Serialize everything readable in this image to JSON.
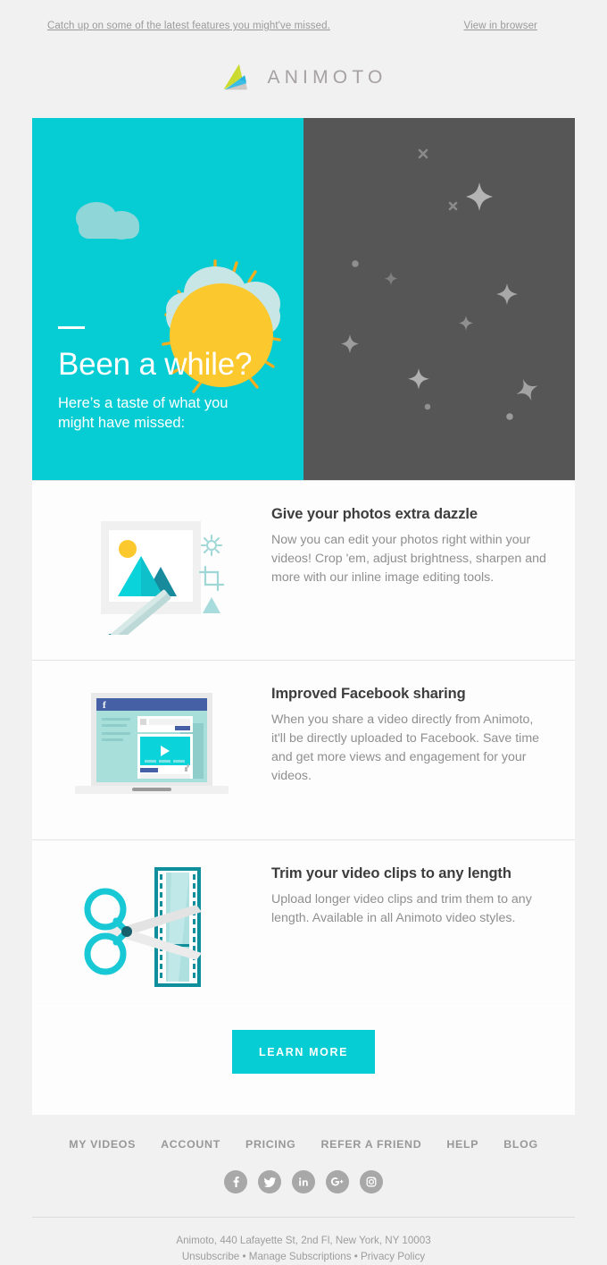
{
  "preheader": {
    "catchup_text": "Catch up on some of the latest features you might've missed.",
    "view_in_browser": "View in browser"
  },
  "brand": {
    "name": "ANIMOTO",
    "logo_icon": "animoto-triangle-logo",
    "colors": {
      "cyan": "#06cdd4",
      "yellow_green": "#d8e06a",
      "blue": "#3bbde4",
      "gray": "#cfcac6",
      "dark_panel": "#565656",
      "page_bg": "#f1f1f1",
      "card_bg": "#fdfdfd",
      "heading": "#3d3d3d",
      "body_text": "#8f8f8f",
      "footer_text": "#989898",
      "sun_yellow": "#fbc82d",
      "cloud": "#bfe3e3"
    }
  },
  "hero": {
    "dash": "",
    "title": "Been a while?",
    "subtitle": "Here’s a taste of what you might have missed:",
    "left_icons": [
      "cloud-icon",
      "sun-icon"
    ],
    "right_icons": [
      "star-icon",
      "sparkle-icon",
      "dot-icon"
    ]
  },
  "features": [
    {
      "icon": "photo-editing-illustration",
      "title": "Give your photos extra dazzle",
      "body": "Now you can edit your photos right within your videos! Crop 'em, adjust brightness, sharpen and more with our inline image editing tools."
    },
    {
      "icon": "facebook-laptop-illustration",
      "title": "Improved Facebook sharing",
      "body": "When you share a video directly from Animoto, it'll be directly uploaded to Facebook. Save time and get more views and engagement for your videos."
    },
    {
      "icon": "scissors-filmstrip-illustration",
      "title": "Trim your video clips to any length",
      "body": "Upload longer video clips and trim them to any length. Available in all Animoto video styles."
    }
  ],
  "cta": {
    "label": "LEARN MORE"
  },
  "footer": {
    "nav": [
      {
        "label": "MY VIDEOS"
      },
      {
        "label": "ACCOUNT"
      },
      {
        "label": "PRICING"
      },
      {
        "label": "REFER A FRIEND"
      },
      {
        "label": "HELP"
      },
      {
        "label": "BLOG"
      }
    ],
    "social": [
      {
        "icon": "facebook-icon",
        "name": "Facebook"
      },
      {
        "icon": "twitter-icon",
        "name": "Twitter"
      },
      {
        "icon": "linkedin-icon",
        "name": "LinkedIn"
      },
      {
        "icon": "googleplus-icon",
        "name": "Google Plus"
      },
      {
        "icon": "instagram-icon",
        "name": "Instagram"
      }
    ],
    "address": "Animoto, 440 Lafayette St, 2nd Fl, New York, NY 10003",
    "link_unsubscribe": "Unsubscribe",
    "sep1": " • ",
    "link_manage": "Manage Subscriptions",
    "sep2": " • ",
    "link_privacy": "Privacy Policy"
  }
}
